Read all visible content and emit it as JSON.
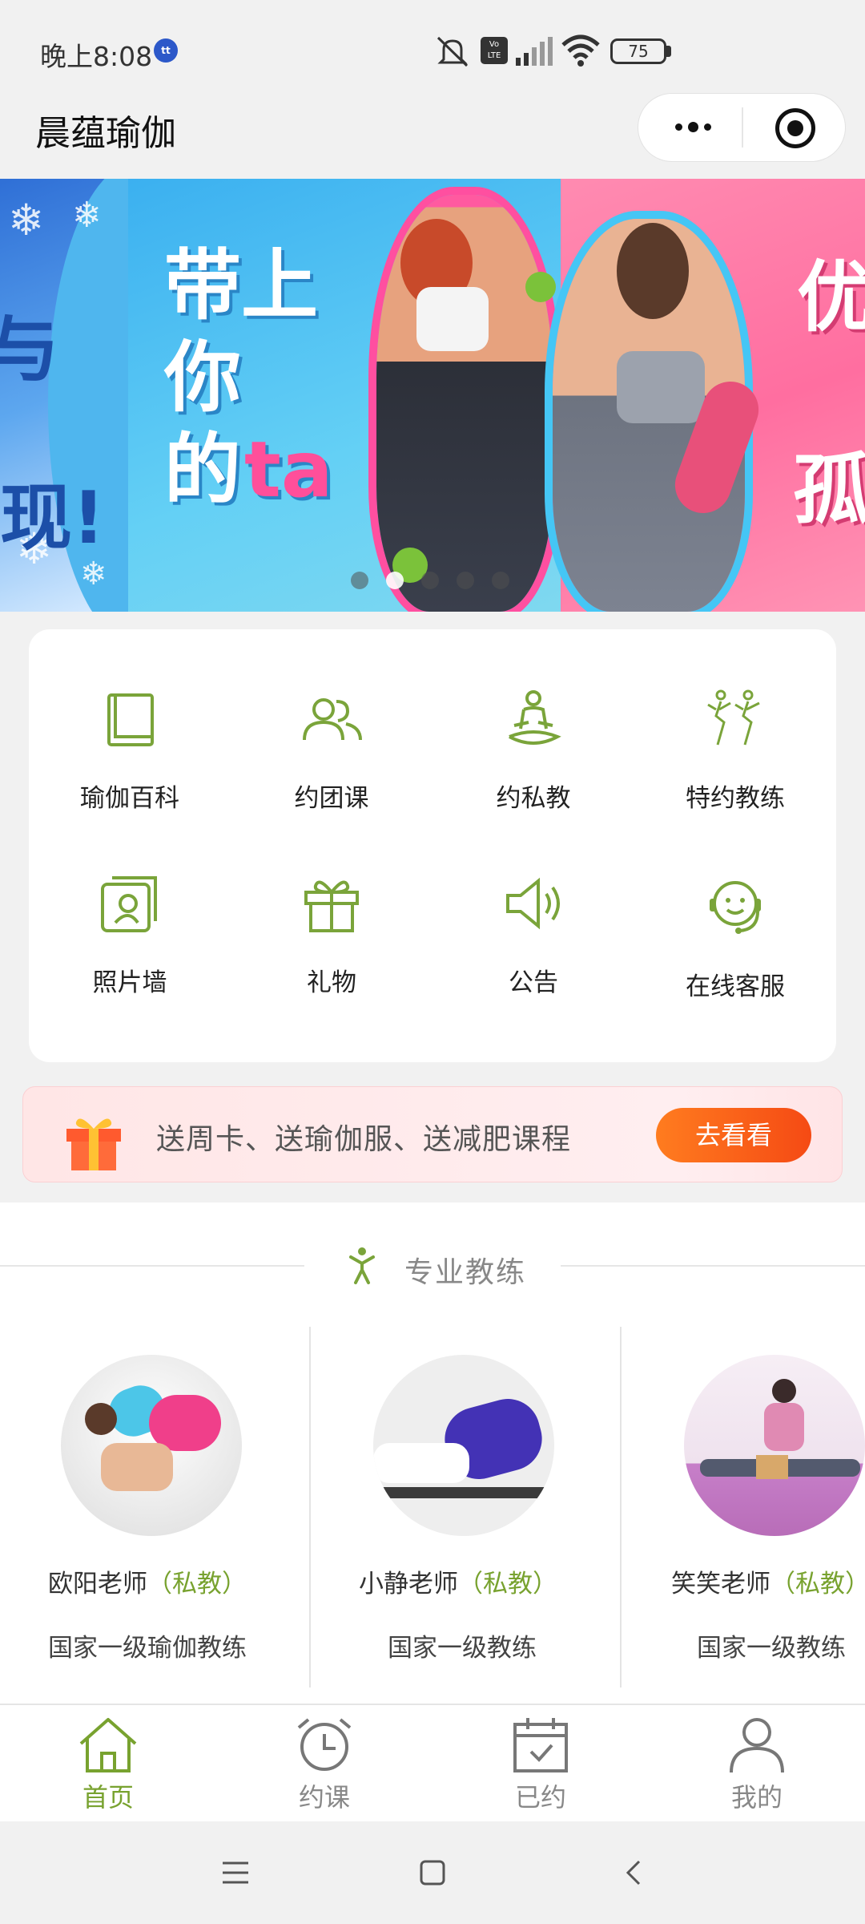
{
  "status_bar": {
    "time": "晚上8:08",
    "carrier_badge": "tt",
    "battery": "75"
  },
  "header": {
    "title": "晨蕴瑜伽"
  },
  "banner": {
    "left_text_1": "与",
    "left_text_2": "现!",
    "middle_text_1": "带上",
    "middle_text_2": "你",
    "middle_text_3": "的",
    "middle_text_accent": "ta",
    "right_text_1": "优",
    "right_text_2": "孤",
    "colors": {
      "left": "#4fb6ee",
      "middle": "#5cc8f4",
      "right": "#ff78a8"
    },
    "dots_count": 5,
    "active_dot": 1
  },
  "grid": {
    "items": [
      {
        "label": "瑜伽百科",
        "icon": "book-icon"
      },
      {
        "label": "约团课",
        "icon": "group-icon"
      },
      {
        "label": "约私教",
        "icon": "meditation-icon"
      },
      {
        "label": "特约教练",
        "icon": "dancers-icon"
      },
      {
        "label": "照片墙",
        "icon": "photo-wall-icon"
      },
      {
        "label": "礼物",
        "icon": "gift-icon"
      },
      {
        "label": "公告",
        "icon": "speaker-icon"
      },
      {
        "label": "在线客服",
        "icon": "headset-icon"
      }
    ],
    "icon_color": "#7aa43a"
  },
  "promo": {
    "text": "送周卡、送瑜伽服、送减肥课程",
    "button": "去看看"
  },
  "coaches": {
    "section_title": "专业教练",
    "items": [
      {
        "name": "欧阳老师",
        "tag": "（私教）",
        "role": "国家一级瑜伽教练"
      },
      {
        "name": "小静老师",
        "tag": "（私教）",
        "role": "国家一级教练"
      },
      {
        "name": "笑笑老师",
        "tag": "（私教）",
        "role": "国家一级教练"
      }
    ]
  },
  "tabbar": {
    "tabs": [
      {
        "label": "首页",
        "icon": "home-icon",
        "active": true
      },
      {
        "label": "约课",
        "icon": "alarm-clock-icon",
        "active": false
      },
      {
        "label": "已约",
        "icon": "calendar-check-icon",
        "active": false
      },
      {
        "label": "我的",
        "icon": "person-icon",
        "active": false
      }
    ],
    "active_color": "#78a22f"
  }
}
